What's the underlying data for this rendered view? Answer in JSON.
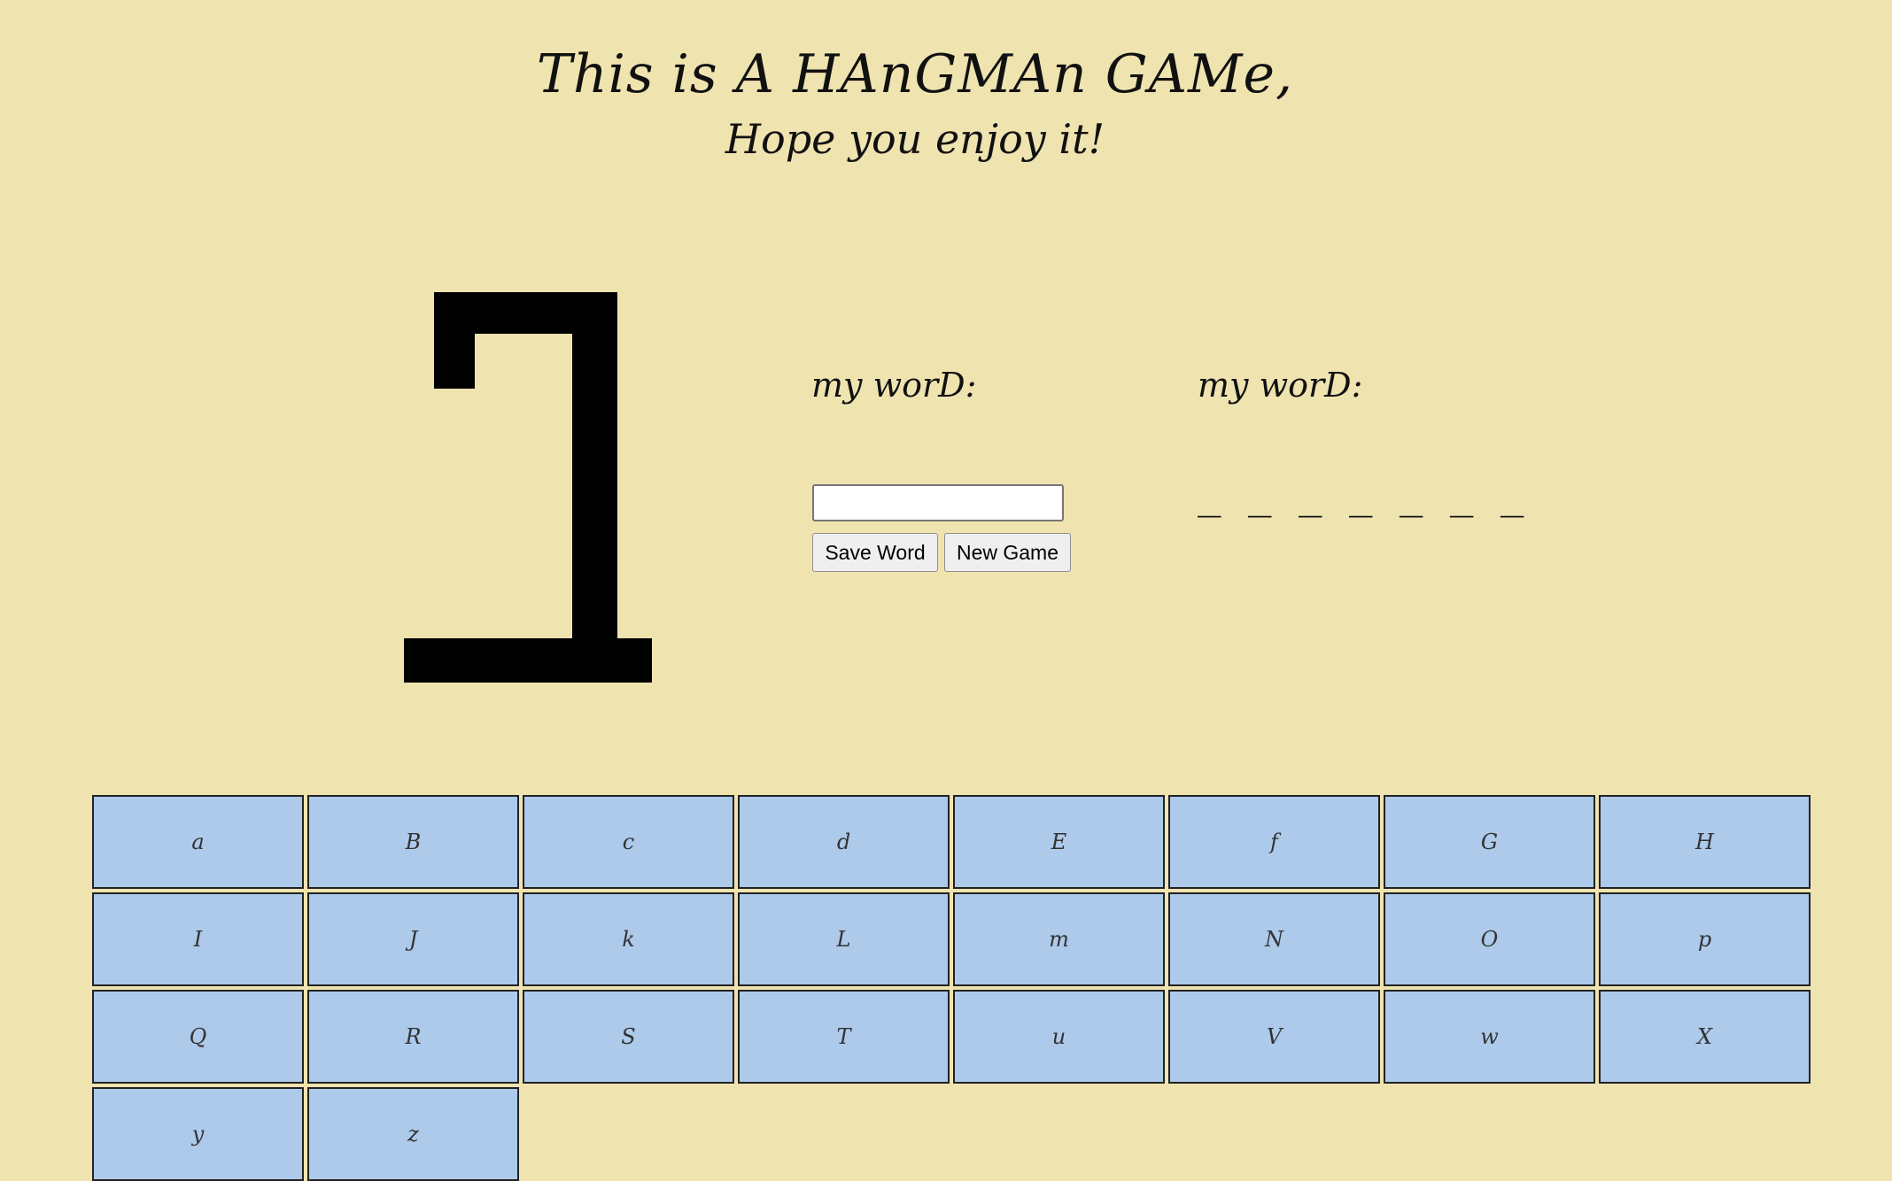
{
  "header": {
    "title": "This is A HAnGMAn GAMe,",
    "subtitle": "Hope you enjoy it!"
  },
  "setter": {
    "word_label": "my worD:",
    "input_value": "",
    "save_label": "Save Word",
    "new_game_label": "New Game"
  },
  "guesser": {
    "word_label": "my worD:",
    "blanks": "_ _ _ _ _ _ _"
  },
  "keyboard": {
    "keys": [
      "a",
      "B",
      "c",
      "d",
      "E",
      "f",
      "G",
      "H",
      "I",
      "J",
      "k",
      "L",
      "m",
      "N",
      "O",
      "p",
      "Q",
      "R",
      "S",
      "T",
      "u",
      "V",
      "w",
      "X",
      "y",
      "z"
    ]
  },
  "colors": {
    "background": "#efe3b0",
    "key_fill": "#adcaeb",
    "gallows": "#000000"
  }
}
